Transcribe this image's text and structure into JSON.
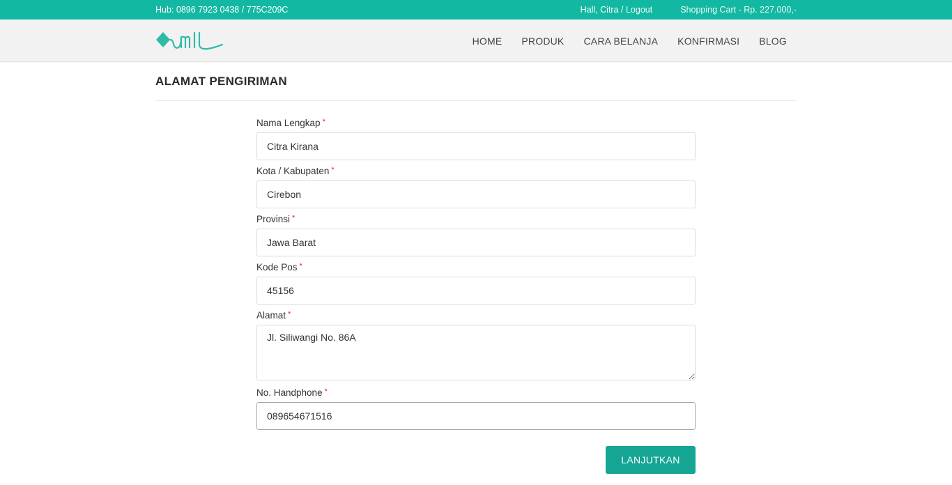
{
  "topbar": {
    "hub_text": "Hub: 0896 7923 0438 / 775C209C",
    "greeting": "Hall, Citra /",
    "logout_label": "Logout",
    "cart_text": "Shopping Cart - Rp. 227.000,-"
  },
  "brand": {
    "accent_color": "#12b8a2",
    "button_color": "#14a593"
  },
  "nav": {
    "items": [
      {
        "label": "HOME"
      },
      {
        "label": "PRODUK"
      },
      {
        "label": "CARA BELANJA"
      },
      {
        "label": "KONFIRMASI"
      },
      {
        "label": "BLOG"
      }
    ]
  },
  "page": {
    "title": "ALAMAT PENGIRIMAN"
  },
  "form": {
    "nama": {
      "label": "Nama Lengkap",
      "value": "Citra Kirana"
    },
    "kota": {
      "label": "Kota / Kabupaten",
      "value": "Cirebon"
    },
    "provinsi": {
      "label": "Provinsi",
      "value": "Jawa Barat"
    },
    "kodepos": {
      "label": "Kode Pos",
      "value": "45156"
    },
    "alamat": {
      "label": "Alamat",
      "value": "Jl. Siliwangi No. 86A"
    },
    "handphone": {
      "label": "No. Handphone",
      "value": "089654671516"
    },
    "required_mark": "*",
    "submit_label": "LANJUTKAN"
  }
}
